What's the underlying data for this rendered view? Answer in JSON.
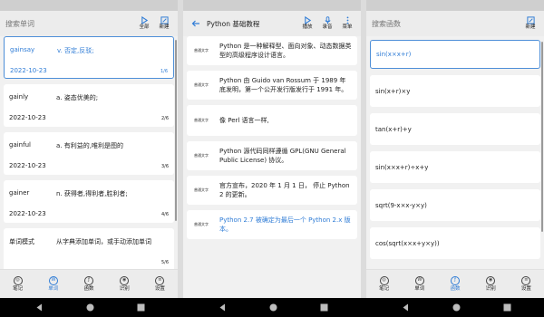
{
  "accent": "#2f7cd6",
  "panel1": {
    "search_placeholder": "搜索单词",
    "toolbar": [
      {
        "icon": "play-icon",
        "label": "全部"
      },
      {
        "icon": "new-icon",
        "label": "新建"
      }
    ],
    "words": [
      {
        "word": "gainsay",
        "meaning": "v. 否定,反驳;",
        "date": "2022-10-23",
        "count": "1/6"
      },
      {
        "word": "gainly",
        "meaning": "a. 姿态优美的;",
        "date": "2022-10-23",
        "count": "2/6"
      },
      {
        "word": "gainful",
        "meaning": "a. 有利益的,唯利是图的",
        "date": "2022-10-23",
        "count": "3/6"
      },
      {
        "word": "gainer",
        "meaning": "n. 获得者,得利者,胜利者;",
        "date": "2022-10-23",
        "count": "4/6"
      },
      {
        "word": "单词模式",
        "meaning": "从字典添加单词，或手动添加单词",
        "date": "",
        "count": "5/6"
      }
    ]
  },
  "panel2": {
    "title": "Python 基础教程",
    "toolbar": [
      {
        "icon": "play-icon",
        "label": "播放"
      },
      {
        "icon": "mic-icon",
        "label": "录音"
      },
      {
        "icon": "more-icon",
        "label": "菜单"
      }
    ],
    "notes": [
      {
        "tag": "普通文字",
        "text": "Python 是一种解释型、面向对象、动态数据类型的高级程序设计语言。"
      },
      {
        "tag": "普通文字",
        "text": "Python 由 Guido van Rossum 于 1989 年底发明，第一个公开发行版发行于 1991 年。"
      },
      {
        "tag": "普通文字",
        "text": "像 Perl 语言一样,"
      },
      {
        "tag": "普通文字",
        "text": " Python 源代码同样遵循 GPL(GNU General Public License) 协议。"
      },
      {
        "tag": "普通文字",
        "text": "官方宣布，2020 年 1 月 1 日， 停止 Python 2 的更新。"
      },
      {
        "tag": "普通文字",
        "text": "Python 2.7 被确定为最后一个 Python 2.x 版本。"
      }
    ]
  },
  "panel3": {
    "search_placeholder": "搜索函数",
    "toolbar": [
      {
        "icon": "new-icon",
        "label": "新建"
      }
    ],
    "functions": [
      "sin(x×x+r)",
      "sin(x+r)×y",
      "tan(x+r)+y",
      "sin(x×x+r)÷x+y",
      "sqrt(9-x×x-y×y)",
      "cos(sqrt(x×x+y×y))"
    ]
  },
  "nav": [
    {
      "icon": "notes-icon",
      "glyph": "◎",
      "label": "笔记"
    },
    {
      "icon": "words-icon",
      "glyph": "W",
      "label": "单词"
    },
    {
      "icon": "function-icon",
      "glyph": "ƒ",
      "label": "函数"
    },
    {
      "icon": "recognize-icon",
      "glyph": "◉",
      "label": "识别"
    },
    {
      "icon": "settings-icon",
      "glyph": "≡",
      "label": "设置"
    }
  ],
  "system_nav": [
    "back",
    "home",
    "recents"
  ]
}
